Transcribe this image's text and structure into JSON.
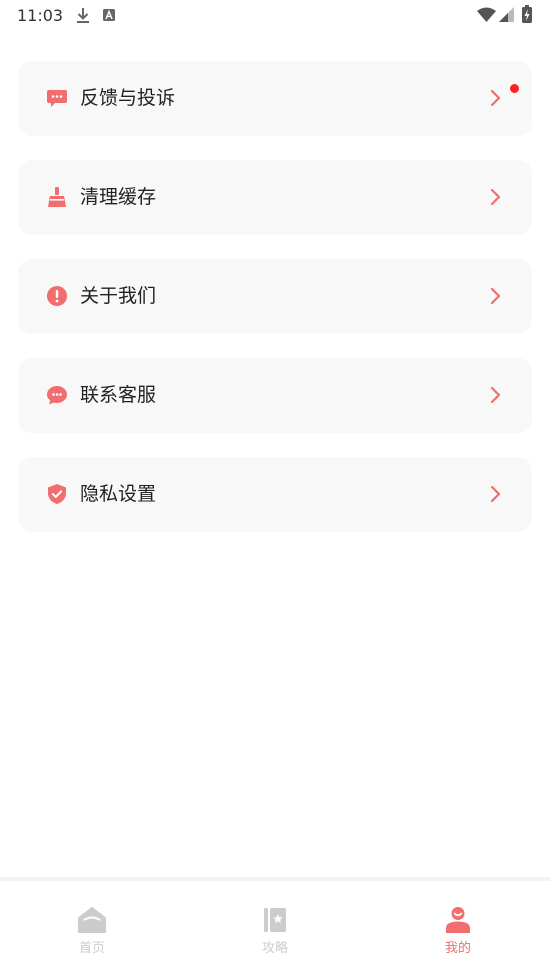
{
  "status_bar": {
    "time": "11:03",
    "icons": [
      "download-icon",
      "text-a-icon",
      "wifi-icon",
      "signal-icon",
      "battery-icon"
    ]
  },
  "menu": {
    "items": [
      {
        "label": "反馈与投诉",
        "icon": "feedback-icon",
        "has_badge": true
      },
      {
        "label": "清理缓存",
        "icon": "broom-icon"
      },
      {
        "label": "关于我们",
        "icon": "info-icon"
      },
      {
        "label": "联系客服",
        "icon": "chat-icon"
      },
      {
        "label": "隐私设置",
        "icon": "shield-icon"
      }
    ]
  },
  "bottom_nav": {
    "tabs": [
      {
        "label": "首页",
        "icon": "home-icon",
        "active": false
      },
      {
        "label": "攻略",
        "icon": "guide-book-icon",
        "active": false
      },
      {
        "label": "我的",
        "icon": "profile-icon",
        "active": true
      }
    ]
  },
  "colors": {
    "accent": "#f26d6d",
    "inactive": "#cccccc",
    "card_bg": "#f8f8f8",
    "badge": "#ff2020"
  }
}
